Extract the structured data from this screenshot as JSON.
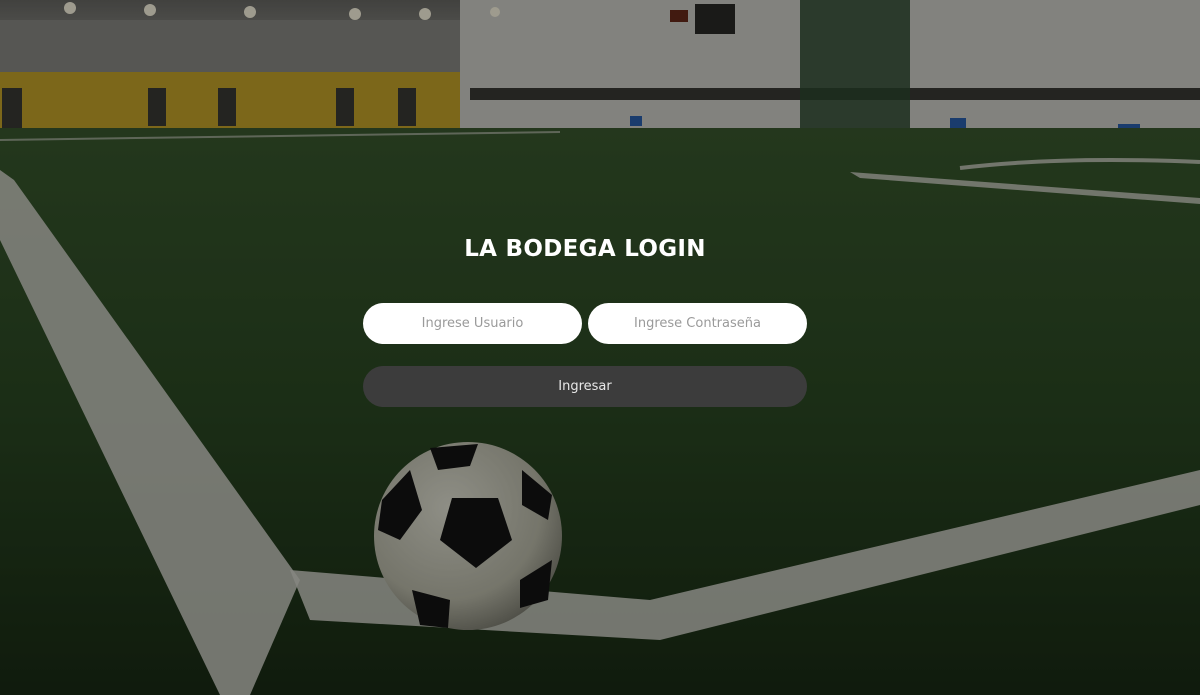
{
  "login": {
    "title": "LA BODEGA LOGIN",
    "username_placeholder": "Ingrese Usuario",
    "password_placeholder": "Ingrese Contraseña",
    "submit_label": "Ingresar"
  },
  "background": {
    "subject": "indoor-soccer-field-photo",
    "turf_color": "#2f4a27",
    "wall_color": "#c9c9c2",
    "accent_wall_color": "#c9a62a",
    "overlay_color": "#000000"
  }
}
